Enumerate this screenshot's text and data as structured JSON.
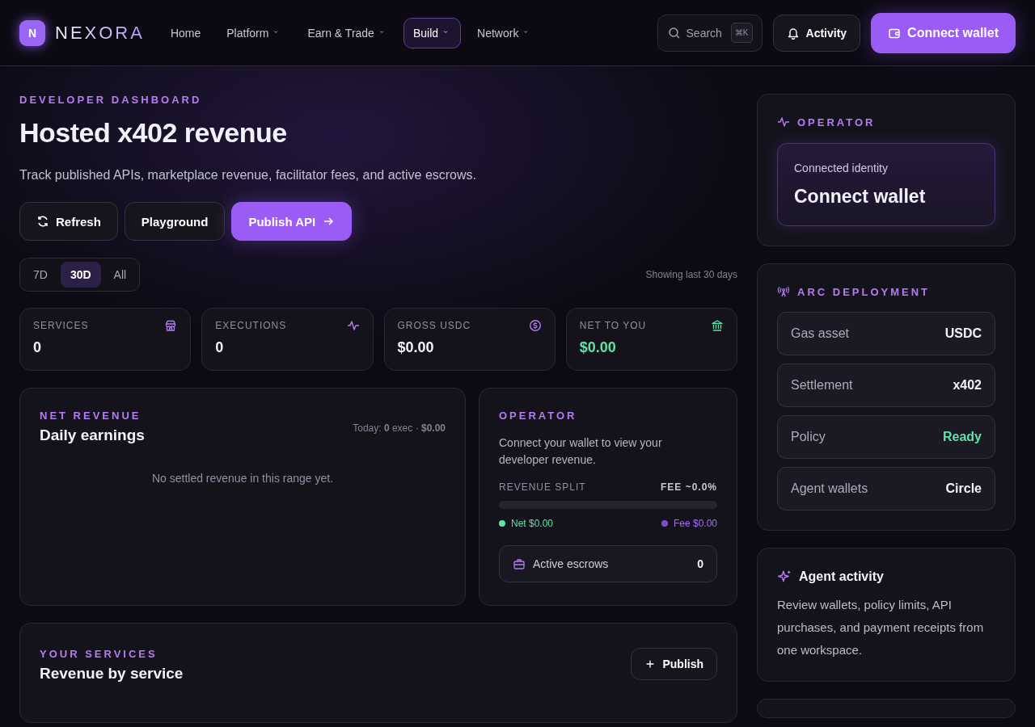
{
  "nav": {
    "logo_badge": "N",
    "logo_text": "NEXORA",
    "links": [
      {
        "label": "Home",
        "dropdown": false,
        "selected": false
      },
      {
        "label": "Platform",
        "dropdown": true,
        "selected": false
      },
      {
        "label": "Earn & Trade",
        "dropdown": true,
        "selected": false
      },
      {
        "label": "Build",
        "dropdown": true,
        "selected": true
      },
      {
        "label": "Network",
        "dropdown": true,
        "selected": false
      }
    ]
  },
  "header_actions": {
    "search": {
      "placeholder": "Search",
      "shortcut": "⌘K"
    },
    "activity": "Activity",
    "connect": "Connect wallet"
  },
  "hero": {
    "eyebrow": "DEVELOPER DASHBOARD",
    "title": "Hosted x402 revenue",
    "subtitle": "Track published APIs, marketplace revenue, facilitator fees, and active escrows.",
    "buttons": [
      {
        "label": "Refresh",
        "kind": "refresh"
      },
      {
        "label": "Playground",
        "kind": "plain"
      },
      {
        "label": "Publish API",
        "kind": "primary"
      }
    ]
  },
  "range": {
    "options": [
      {
        "label": "7D",
        "selected": false
      },
      {
        "label": "30D",
        "selected": true
      },
      {
        "label": "All",
        "selected": false
      }
    ],
    "note": "Showing last 30 days"
  },
  "stats": [
    {
      "label": "SERVICES",
      "value": "0",
      "highlighted": false
    },
    {
      "label": "EXECUTIONS",
      "value": "0",
      "highlighted": false
    },
    {
      "label": "GROSS USDC",
      "value": "$0.00",
      "highlighted": false
    },
    {
      "label": "NET TO YOU",
      "value": "$0.00",
      "highlighted": true
    }
  ],
  "daily": {
    "eyebrow": "NET REVENUE",
    "title": "Daily earnings",
    "today": "Today: **0** exec · **$0.00**",
    "empty": "No settled revenue in this range yet."
  },
  "operator": {
    "eyebrow": "OPERATOR",
    "text": "Connect your wallet to view your developer revenue.",
    "split_label": "REVENUE SPLIT",
    "fee": "FEE ~0.0%",
    "level": 0,
    "legend": [
      {
        "label": "Net $0.00",
        "color": "#5ee3a8"
      },
      {
        "label": "Fee $0.00",
        "color": "#7c4fcc"
      }
    ],
    "escrows": {
      "label": "Active escrows",
      "value": "0"
    }
  },
  "services": {
    "eyebrow": "YOUR SERVICES",
    "title": "Revenue by service",
    "button": "Publish"
  },
  "sidebar": {
    "operator": {
      "eyebrow": "OPERATOR",
      "identity_label": "Connected identity",
      "identity_value": "Connect wallet"
    },
    "deployment": {
      "eyebrow": "ARC DEPLOYMENT",
      "rows": [
        {
          "label": "Gas asset",
          "value": "USDC",
          "highlighted": false
        },
        {
          "label": "Settlement",
          "value": "x402",
          "highlighted": false
        },
        {
          "label": "Policy",
          "value": "Ready",
          "highlighted": true
        },
        {
          "label": "Agent wallets",
          "value": "Circle",
          "highlighted": false
        }
      ]
    },
    "agent": {
      "title": "Agent activity",
      "text": "Review wallets, policy limits, API purchases, and payment receipts from one workspace."
    }
  }
}
